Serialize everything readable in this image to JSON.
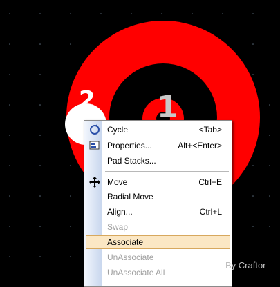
{
  "canvas": {
    "background": "#000000",
    "pad_color": "#ff0000",
    "hole_color": "#000000",
    "label_color": "#c8c8c8",
    "pin_label": "1",
    "neighbor_label": "2"
  },
  "menu": {
    "items": [
      {
        "label": "Cycle",
        "shortcut": "<Tab>",
        "icon": "cycle-icon",
        "enabled": true
      },
      {
        "label": "Properties...",
        "shortcut": "Alt+<Enter>",
        "icon": "properties-icon",
        "enabled": true
      },
      {
        "label": "Pad Stacks...",
        "shortcut": "",
        "icon": "",
        "enabled": true
      },
      {
        "label": "Move",
        "shortcut": "Ctrl+E",
        "icon": "move-arrows-icon",
        "enabled": true
      },
      {
        "label": "Radial Move",
        "shortcut": "",
        "icon": "",
        "enabled": true
      },
      {
        "label": "Align...",
        "shortcut": "Ctrl+L",
        "icon": "",
        "enabled": true
      },
      {
        "label": "Swap",
        "shortcut": "",
        "icon": "",
        "enabled": false
      },
      {
        "label": "Associate",
        "shortcut": "",
        "icon": "",
        "enabled": true,
        "highlighted": true
      },
      {
        "label": "UnAssociate",
        "shortcut": "",
        "icon": "",
        "enabled": false
      },
      {
        "label": "UnAssociate All",
        "shortcut": "",
        "icon": "",
        "enabled": false
      }
    ],
    "highlight_bg": "#fbe7c4"
  },
  "watermark": "By Craftor"
}
